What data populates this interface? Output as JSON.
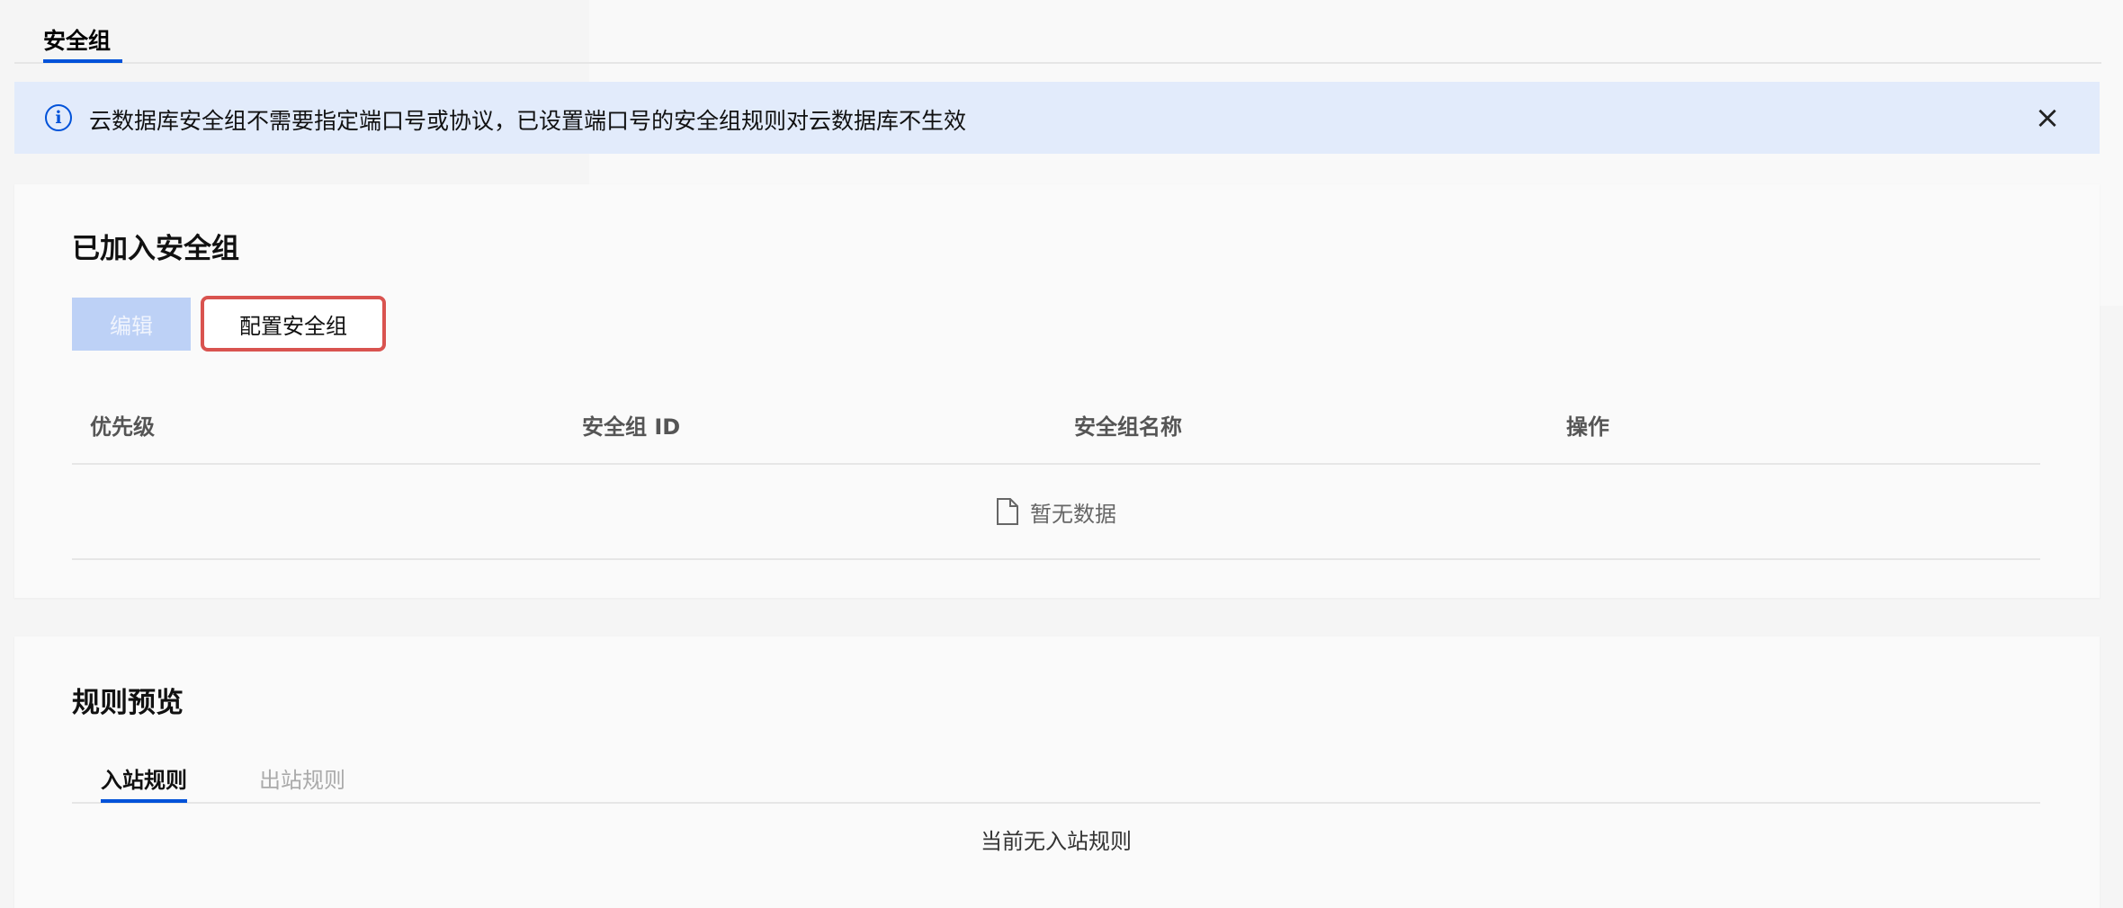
{
  "tabs": {
    "active_label": "安全组"
  },
  "banner": {
    "icon": "info-icon",
    "text": "云数据库安全组不需要指定端口号或协议，已设置端口号的安全组规则对云数据库不生效",
    "close_icon": "close-icon"
  },
  "joined": {
    "title": "已加入安全组",
    "edit_label": "编辑",
    "config_label": "配置安全组",
    "columns": [
      "优先级",
      "安全组 ID",
      "安全组名称",
      "操作"
    ],
    "empty_text": "暂无数据",
    "empty_icon": "file-icon"
  },
  "rules": {
    "title": "规则预览",
    "tabs": [
      "入站规则",
      "出站规则"
    ],
    "empty_text": "当前无入站规则"
  },
  "colors": {
    "accent": "#0052d9",
    "banner_bg": "#e2ebfb",
    "highlight_border": "#d9534f",
    "disabled_button": "#bdd1f6"
  }
}
